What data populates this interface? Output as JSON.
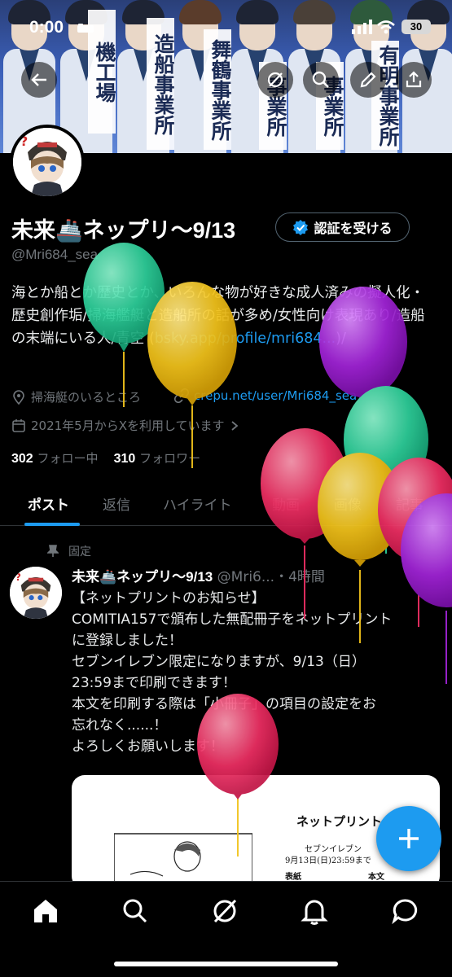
{
  "status_bar": {
    "time": "0:00",
    "battery": "30"
  },
  "banner": {
    "labels": [
      "機工場",
      "造船事業所",
      "舞鶴事業所",
      "事業所",
      "事業所",
      "有明事業所"
    ]
  },
  "profile": {
    "name": "未来🚢ネップリ〜9/13",
    "verify_label": "認証を受ける",
    "handle": "@Mri684_sea",
    "bio_text": "海とか船とか歴史とか、いろんな物が好きな成人済みの擬人化・歴史創作垢/掃海艦艇と造船所の話が多め/女性向け表現あり/造船の末端にいる人/青空 (",
    "bio_link": "bsky.app/profile/mri684...",
    "bio_end": ")/",
    "location": "掃海艇のいるところ",
    "website": "crepu.net/user/Mri684_sea",
    "joined": "2021年5月からXを利用しています",
    "following_count": "302",
    "following_label": "フォロー中",
    "followers_count": "310",
    "followers_label": "フォロワー"
  },
  "tabs": [
    "ポスト",
    "返信",
    "ハイライト",
    "動画",
    "画像",
    "記事"
  ],
  "post": {
    "pinned_label": "固定",
    "author": "未来🚢ネップリ〜9/13",
    "handle": "@Mri6...",
    "time": "・4時間",
    "lines": [
      "【ネットプリントのお知らせ】",
      "COMITIA157で頒布した無配冊子をネットプリント",
      "に登録しました！",
      "セブンイレブン限定になりますが、9/13（日）",
      "23:59まで印刷できます！",
      "本文を印刷する際は「小冊子」の項目の設定をお",
      "忘れなく......！",
      "よろしくお願いします！"
    ],
    "card": {
      "title": "ネットプリント",
      "sub1": "セブンイレブン",
      "sub2": "9月13日(日)23:59まで",
      "col1": "表紙",
      "col2": "本文"
    }
  },
  "colors": {
    "accent": "#1d9bf0",
    "balloon_green": "#2ecf9a",
    "balloon_yellow": "#f2c31b",
    "balloon_purple": "#a224d8",
    "balloon_red": "#ee2f63"
  },
  "nav": [
    "home-icon",
    "search-icon",
    "grok-icon",
    "notifications-icon",
    "messages-icon"
  ]
}
